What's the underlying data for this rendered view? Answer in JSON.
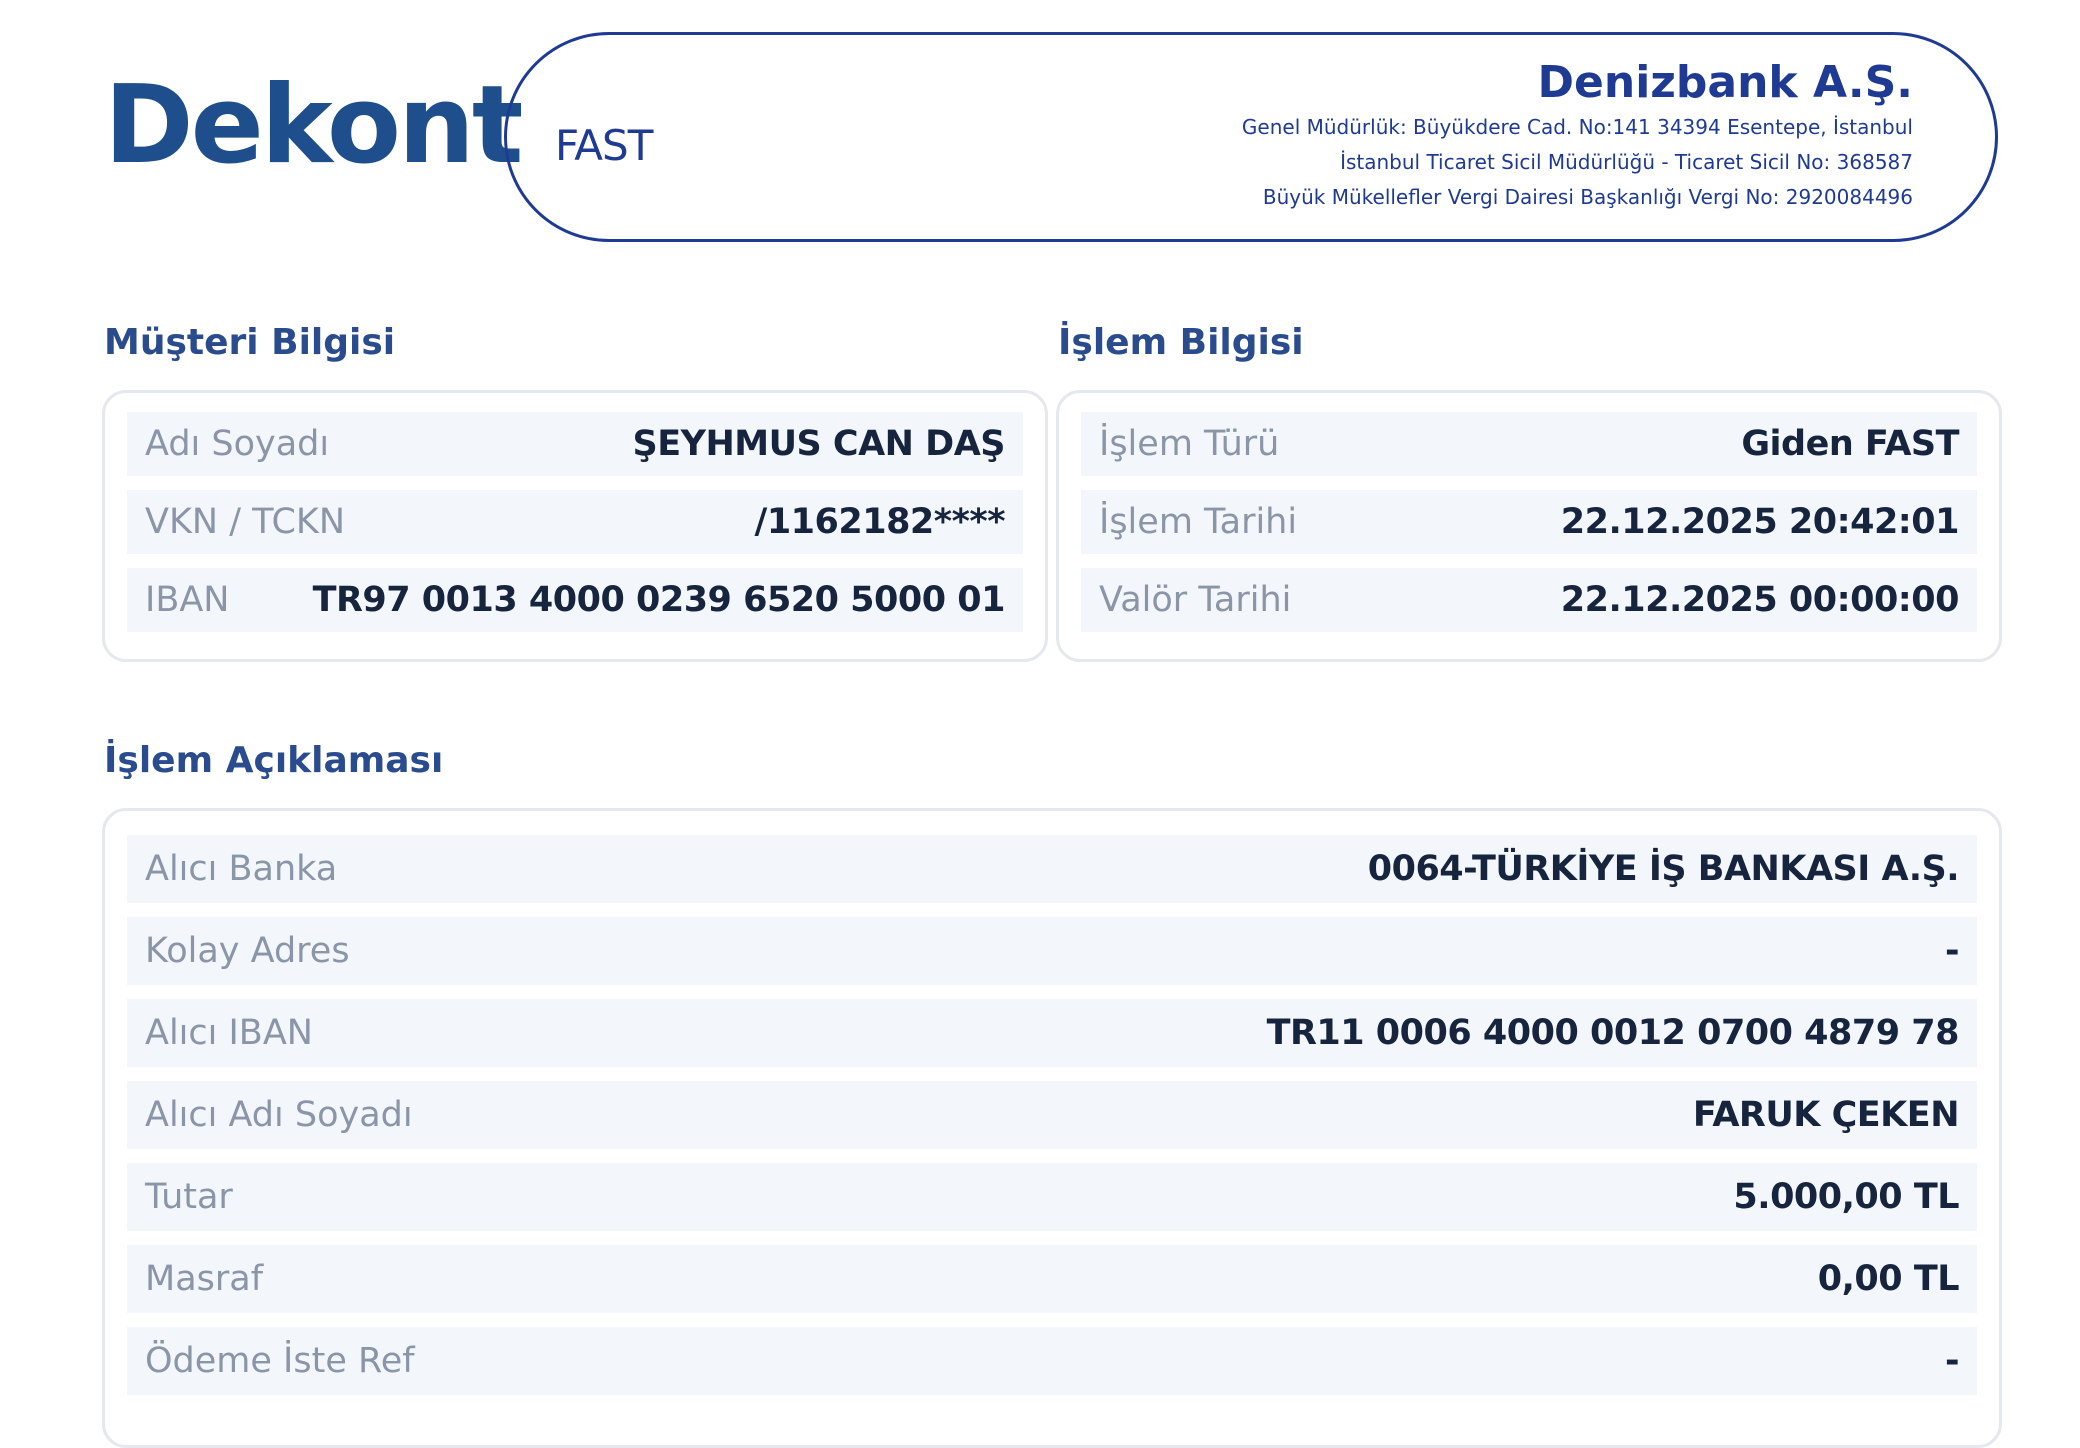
{
  "header": {
    "title": "Dekont",
    "transaction_type": "FAST",
    "bank": {
      "name": "Denizbank A.Ş.",
      "lines": [
        "Genel Müdürlük: Büyükdere Cad. No:141 34394 Esentepe, İstanbul",
        "İstanbul Ticaret Sicil Müdürlüğü - Ticaret Sicil No: 368587",
        "Büyük Mükellefler Vergi Dairesi Başkanlığı Vergi No: 2920084496"
      ]
    }
  },
  "customer": {
    "title": "Müşteri Bilgisi",
    "rows": [
      {
        "label": "Adı Soyadı",
        "value": "ŞEYHMUS CAN DAŞ"
      },
      {
        "label": "VKN / TCKN",
        "value": "/1162182****"
      },
      {
        "label": "IBAN",
        "value": "TR97 0013 4000 0239 6520 5000 01"
      }
    ]
  },
  "transaction": {
    "title": "İşlem Bilgisi",
    "rows": [
      {
        "label": "İşlem Türü",
        "value": "Giden FAST"
      },
      {
        "label": "İşlem Tarihi",
        "value": "22.12.2025 20:42:01"
      },
      {
        "label": "Valör Tarihi",
        "value": "22.12.2025 00:00:00"
      }
    ]
  },
  "description": {
    "title": "İşlem Açıklaması",
    "rows": [
      {
        "label": "Alıcı Banka",
        "value": "0064-TÜRKİYE İŞ BANKASI A.Ş."
      },
      {
        "label": "Kolay Adres",
        "value": "-"
      },
      {
        "label": "Alıcı IBAN",
        "value": "TR11 0006 4000 0012 0700 4879 78"
      },
      {
        "label": "Alıcı Adı Soyadı",
        "value": "FARUK ÇEKEN"
      },
      {
        "label": "Tutar",
        "value": "5.000,00 TL"
      },
      {
        "label": "Masraf",
        "value": "0,00 TL"
      },
      {
        "label": "Ödeme İste Ref",
        "value": "-"
      }
    ]
  }
}
